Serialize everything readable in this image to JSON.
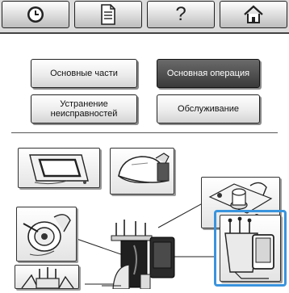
{
  "toolbar": {
    "items": [
      {
        "name": "clock",
        "icon": "clock-icon"
      },
      {
        "name": "document",
        "icon": "document-icon"
      },
      {
        "name": "help",
        "icon": "question-icon",
        "label": "?"
      },
      {
        "name": "home",
        "icon": "home-icon"
      }
    ]
  },
  "menu": {
    "basic_parts": "Основные части",
    "basic_operation": "Основная операция",
    "troubleshooting": "Устранение\nнеисправностей",
    "maintenance": "Обслуживание"
  },
  "illustrations": [
    {
      "name": "embroidery-frame",
      "icon": "embroidery-frame-icon"
    },
    {
      "name": "cap-frame",
      "icon": "cap-frame-icon"
    },
    {
      "name": "bobbin",
      "icon": "bobbin-icon"
    },
    {
      "name": "thread-spool",
      "icon": "thread-spool-icon"
    },
    {
      "name": "machine-closeup",
      "icon": "machine-icon",
      "selected": true
    },
    {
      "name": "thread-guides",
      "icon": "thread-guide-icon"
    }
  ],
  "colors": {
    "accent": "#3a94dd",
    "active_button": "#4a4a4a",
    "toolbar_bg": "#dcdcdc"
  }
}
